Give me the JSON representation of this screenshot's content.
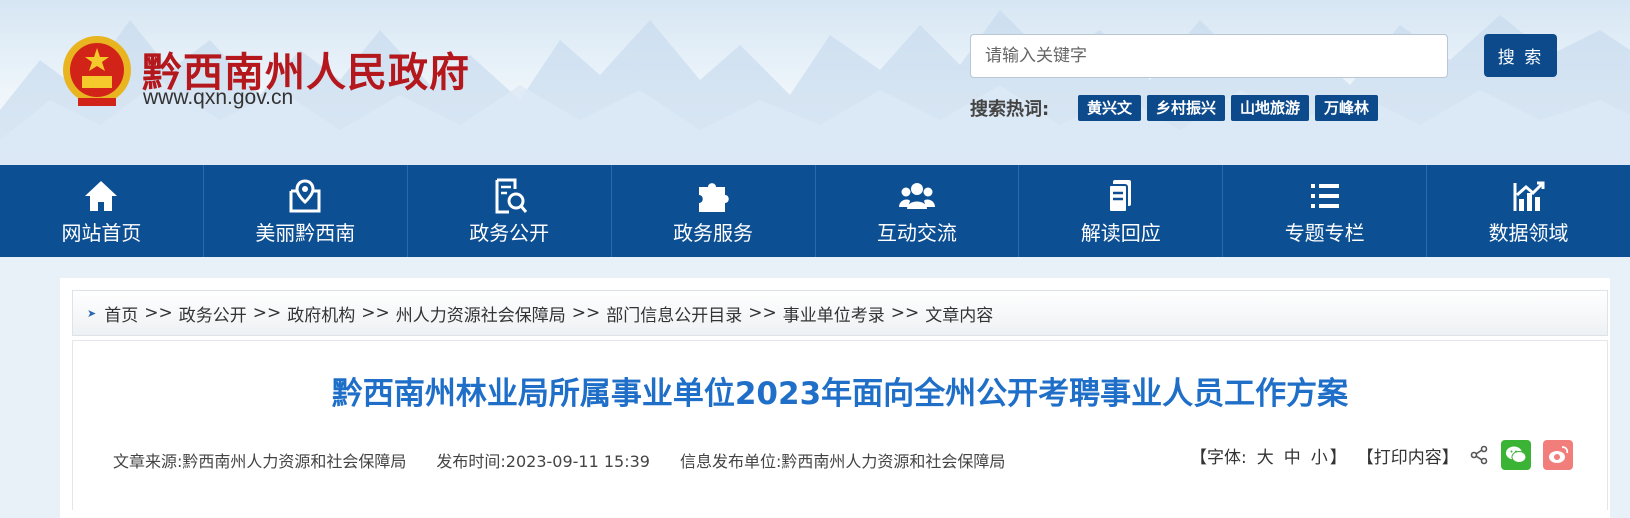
{
  "header": {
    "site_name": "黔西南州人民政府",
    "site_url": "www.qxn.gov.cn",
    "search_placeholder": "请输入关键字",
    "search_button": "搜 索",
    "hot_label": "搜索热词:",
    "hot_tags": [
      "黄兴文",
      "乡村振兴",
      "山地旅游",
      "万峰林"
    ]
  },
  "nav": {
    "items": [
      {
        "label": "网站首页",
        "icon": "home-icon"
      },
      {
        "label": "美丽黔西南",
        "icon": "map-pin-icon"
      },
      {
        "label": "政务公开",
        "icon": "document-search-icon"
      },
      {
        "label": "政务服务",
        "icon": "puzzle-icon"
      },
      {
        "label": "互动交流",
        "icon": "users-icon"
      },
      {
        "label": "解读回应",
        "icon": "document-icon"
      },
      {
        "label": "专题专栏",
        "icon": "list-icon"
      },
      {
        "label": "数据领域",
        "icon": "chart-icon"
      }
    ]
  },
  "breadcrumb": {
    "items": [
      "首页",
      "政务公开",
      "政府机构",
      "州人力资源社会保障局",
      "部门信息公开目录",
      "事业单位考录",
      "文章内容"
    ],
    "separator": ">>"
  },
  "article": {
    "title": "黔西南州林业局所属事业单位2023年面向全州公开考聘事业人员工作方案",
    "source": "文章来源:黔西南州人力资源和社会保障局",
    "publish_time": "发布时间:2023-09-11 15:39",
    "publisher": "信息发布单位:黔西南州人力资源和社会保障局"
  },
  "tools": {
    "font_label": "【字体:",
    "font_large": "大",
    "font_medium": "中",
    "font_small": "小",
    "font_close": "】",
    "print": "【打印内容】"
  },
  "colors": {
    "nav_bg": "#0c4f93",
    "brand_red": "#b4171c",
    "title_blue": "#1f6fc9",
    "wechat_green": "#3bb435",
    "weibo_pink": "#f27e7b"
  }
}
